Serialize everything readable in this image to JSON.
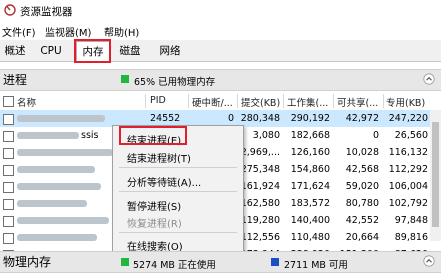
{
  "window": {
    "title": "资源监视器"
  },
  "menu": {
    "items": [
      "文件(F)",
      "监视器(M)",
      "帮助(H)"
    ]
  },
  "tabs": {
    "items": [
      "概述",
      "CPU",
      "内存",
      "磁盘",
      "网络"
    ],
    "active_index": 2
  },
  "process_section": {
    "title": "进程",
    "legend_color": "#1fb83c",
    "legend_text": "65% 已用物理内存"
  },
  "table": {
    "columns": [
      "名称",
      "PID",
      "硬中断/...",
      "提交(KB)",
      "工作集(...",
      "可共享(...",
      "专用(KB)"
    ],
    "rows": [
      {
        "name_visible": "",
        "pid": "24552",
        "hard_faults": "0",
        "commit": "280,348",
        "working_set": "290,192",
        "shareable": "42,972",
        "private": "247,220",
        "selected": true
      },
      {
        "name_visible": "ssis",
        "pid": "",
        "hard_faults": "",
        "commit": "3,080",
        "working_set": "182,668",
        "shareable": "0",
        "private": "26,560",
        "selected": false
      },
      {
        "name_visible": "",
        "pid": "",
        "hard_faults": "",
        "commit": "2,969,...",
        "working_set": "126,160",
        "shareable": "10,028",
        "private": "116,132",
        "selected": false
      },
      {
        "name_visible": "",
        "pid": "",
        "hard_faults": "",
        "commit": "275,348",
        "working_set": "154,860",
        "shareable": "42,568",
        "private": "112,292",
        "selected": false
      },
      {
        "name_visible": "",
        "pid": "",
        "hard_faults": "",
        "commit": "161,924",
        "working_set": "171,624",
        "shareable": "59,020",
        "private": "106,004",
        "selected": false
      },
      {
        "name_visible": "",
        "pid": "",
        "hard_faults": "",
        "commit": "162,580",
        "working_set": "183,572",
        "shareable": "80,780",
        "private": "102,792",
        "selected": false
      },
      {
        "name_visible": "",
        "pid": "",
        "hard_faults": "",
        "commit": "119,280",
        "working_set": "140,400",
        "shareable": "42,552",
        "private": "97,848",
        "selected": false
      },
      {
        "name_visible": "",
        "pid": "",
        "hard_faults": "",
        "commit": "112,556",
        "working_set": "110,480",
        "shareable": "20,664",
        "private": "89,816",
        "selected": false
      },
      {
        "name_visible": "e",
        "pid": "",
        "hard_faults": "",
        "commit": "173,944",
        "working_set": "238,920",
        "shareable": "151,300",
        "private": "87,620",
        "selected": false
      }
    ]
  },
  "context_menu": {
    "items": [
      {
        "label": "结束进程(E)",
        "disabled": false
      },
      {
        "label": "结束进程树(T)",
        "disabled": false
      },
      {
        "label": "分析等待链(A)...",
        "disabled": false
      },
      {
        "label": "暂停进程(S)",
        "disabled": false
      },
      {
        "label": "恢复进程(R)",
        "disabled": true
      },
      {
        "label": "在线搜索(O)",
        "disabled": false
      }
    ]
  },
  "memory_section": {
    "title": "物理内存",
    "in_use_color": "#1fb83c",
    "in_use_text": "5274 MB 正在使用",
    "available_color": "#1e4ec4",
    "available_text": "2711 MB 可用"
  },
  "colors": {
    "highlight": "#e0202e",
    "selection": "#cce8ff"
  }
}
